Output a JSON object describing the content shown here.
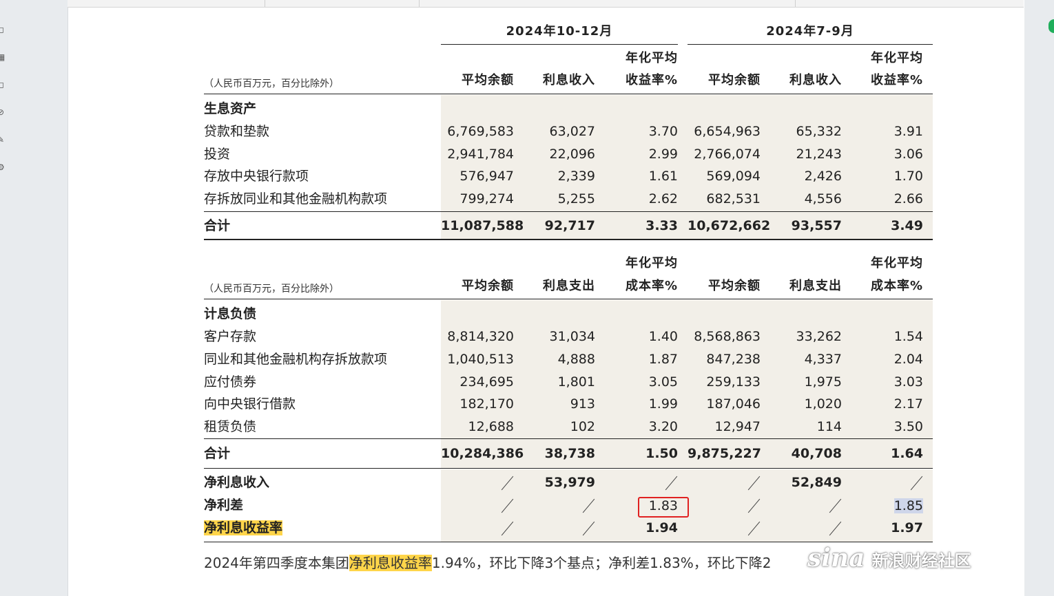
{
  "unit_note": "（人民币百万元，百分比除外）",
  "periods": [
    "2024年10-12月",
    "2024年7-9月"
  ],
  "assets_table": {
    "col_headers": [
      "平均余额",
      "利息收入",
      "年化平均",
      "收益率%",
      "平均余额",
      "利息收入",
      "年化平均",
      "收益率%"
    ],
    "section_title": "生息资产",
    "rows": [
      {
        "label": "贷款和垫款",
        "v": [
          "6,769,583",
          "63,027",
          "3.70",
          "6,654,963",
          "65,332",
          "3.91"
        ]
      },
      {
        "label": "投资",
        "v": [
          "2,941,784",
          "22,096",
          "2.99",
          "2,766,074",
          "21,243",
          "3.06"
        ]
      },
      {
        "label": "存放中央银行款项",
        "v": [
          "576,947",
          "2,339",
          "1.61",
          "569,094",
          "2,426",
          "1.70"
        ]
      },
      {
        "label": "存拆放同业和其他金融机构款项",
        "v": [
          "799,274",
          "5,255",
          "2.62",
          "682,531",
          "4,556",
          "2.66"
        ]
      }
    ],
    "total": {
      "label": "合计",
      "v": [
        "11,087,588",
        "92,717",
        "3.33",
        "10,672,662",
        "93,557",
        "3.49"
      ]
    }
  },
  "liab_table": {
    "col_headers": [
      "平均余额",
      "利息支出",
      "年化平均",
      "成本率%",
      "平均余额",
      "利息支出",
      "年化平均",
      "成本率%"
    ],
    "section_title": "计息负债",
    "rows": [
      {
        "label": "客户存款",
        "v": [
          "8,814,320",
          "31,034",
          "1.40",
          "8,568,863",
          "33,262",
          "1.54"
        ]
      },
      {
        "label": "同业和其他金融机构存拆放款项",
        "v": [
          "1,040,513",
          "4,888",
          "1.87",
          "847,238",
          "4,337",
          "2.04"
        ]
      },
      {
        "label": "应付债券",
        "v": [
          "234,695",
          "1,801",
          "3.05",
          "259,133",
          "1,975",
          "3.03"
        ]
      },
      {
        "label": "向中央银行借款",
        "v": [
          "182,170",
          "913",
          "1.99",
          "187,046",
          "1,020",
          "2.17"
        ]
      },
      {
        "label": "租赁负债",
        "v": [
          "12,688",
          "102",
          "3.20",
          "12,947",
          "114",
          "3.50"
        ]
      }
    ],
    "total": {
      "label": "合计",
      "v": [
        "10,284,386",
        "38,738",
        "1.50",
        "9,875,227",
        "40,708",
        "1.64"
      ]
    }
  },
  "summary": {
    "nii": {
      "label": "净利息收入",
      "v2": "53,979",
      "v5": "52,849"
    },
    "spread": {
      "label": "净利差",
      "v3": "1.83",
      "v6": "1.85"
    },
    "nim": {
      "label": "净利息收益率",
      "v3": "1.94",
      "v6": "1.97"
    }
  },
  "paragraph": {
    "p1": "2024年第四季度本集团",
    "hl": "净利息收益率",
    "p2": "1.94%，环比下降3个基点；净利差1.83%，环比下降2"
  },
  "watermark": {
    "logo": "sina",
    "text": "新浪财经社区"
  },
  "colors": {
    "shade": "#f2efe8",
    "highlight": "#ffd54a",
    "redbox": "#e02020",
    "selection": "#cfd6ea"
  }
}
